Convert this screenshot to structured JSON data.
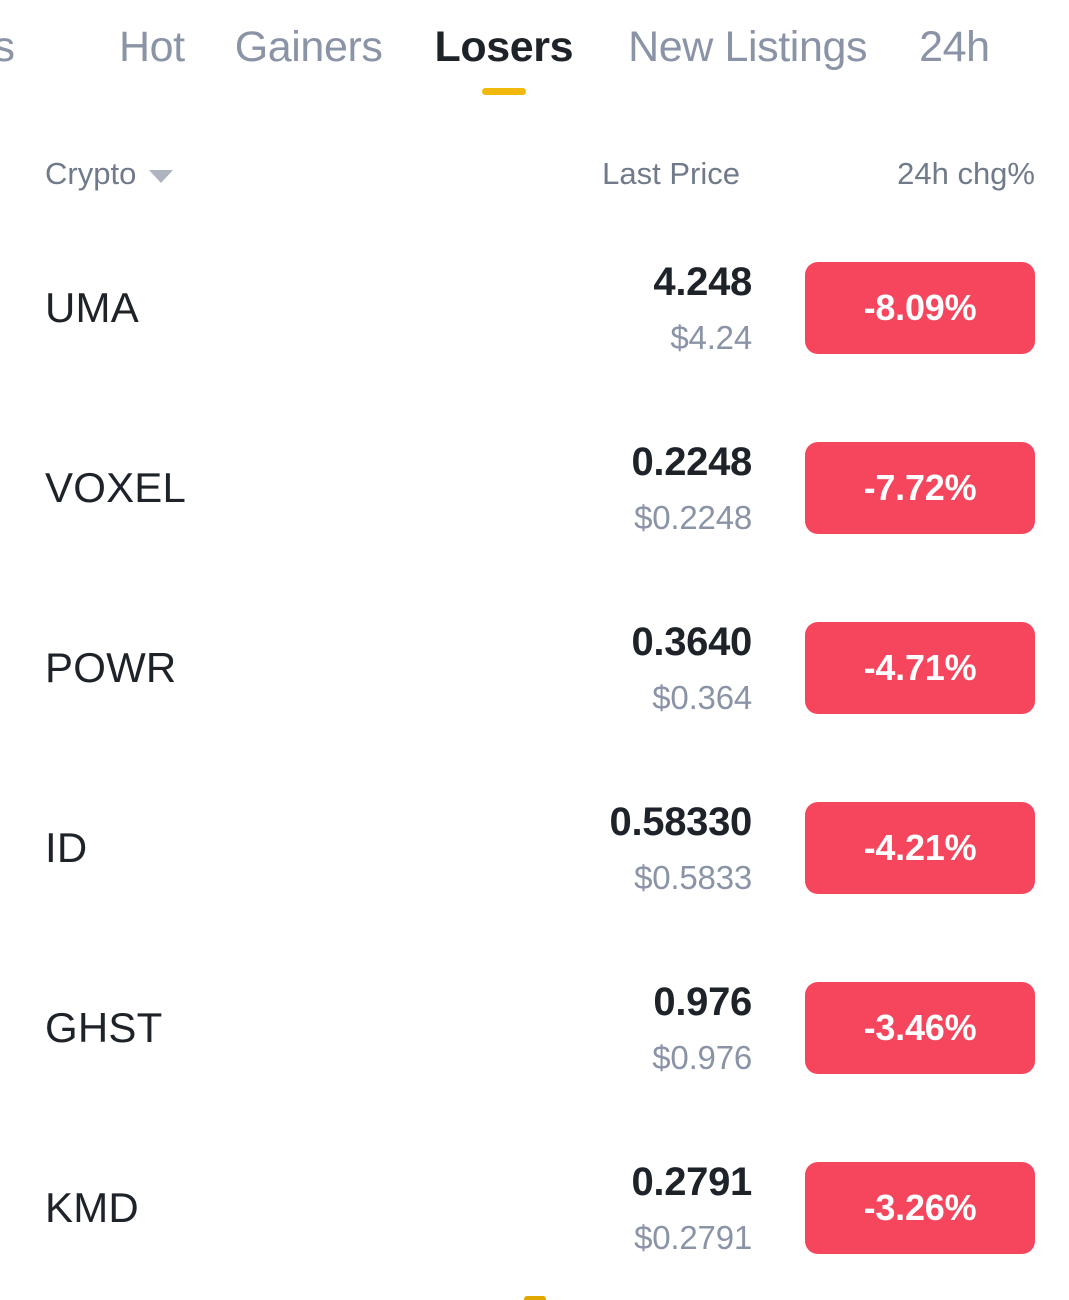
{
  "tabs": [
    {
      "label": "es",
      "name": "tab-favorites",
      "active": false,
      "clipped": true
    },
    {
      "label": "Hot",
      "name": "tab-hot",
      "active": false,
      "clipped": false
    },
    {
      "label": "Gainers",
      "name": "tab-gainers",
      "active": false,
      "clipped": false
    },
    {
      "label": "Losers",
      "name": "tab-losers",
      "active": true,
      "clipped": false
    },
    {
      "label": "New Listings",
      "name": "tab-new-listings",
      "active": false,
      "clipped": false
    },
    {
      "label": "24h",
      "name": "tab-24h-vol",
      "active": false,
      "clipped": true
    }
  ],
  "active_tab": "Losers",
  "columns": {
    "crypto": "Crypto",
    "sort_icon": "caret-down-icon",
    "last_price": "Last Price",
    "change": "24h chg%"
  },
  "rows": [
    {
      "symbol": "UMA",
      "price": "4.248",
      "fiat": "$4.24",
      "change": "-8.09%"
    },
    {
      "symbol": "VOXEL",
      "price": "0.2248",
      "fiat": "$0.2248",
      "change": "-7.72%"
    },
    {
      "symbol": "POWR",
      "price": "0.3640",
      "fiat": "$0.364",
      "change": "-4.71%"
    },
    {
      "symbol": "ID",
      "price": "0.58330",
      "fiat": "$0.5833",
      "change": "-4.21%"
    },
    {
      "symbol": "GHST",
      "price": "0.976",
      "fiat": "$0.976",
      "change": "-3.46%"
    },
    {
      "symbol": "KMD",
      "price": "0.2791",
      "fiat": "$0.2791",
      "change": "-3.26%"
    }
  ],
  "colors": {
    "accent_yellow": "#F0B90B",
    "negative_red": "#F6465D",
    "text_primary": "#1E2329",
    "text_secondary": "#707A8A",
    "text_muted": "#8A94A6",
    "background": "#FFFFFF"
  }
}
